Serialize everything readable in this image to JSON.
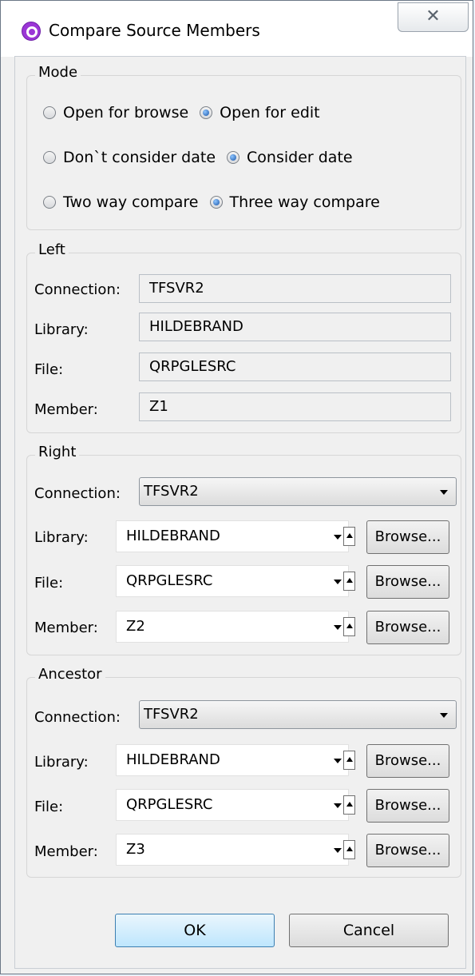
{
  "window": {
    "title": "Compare Source Members",
    "close_label": "✕"
  },
  "mode": {
    "legend": "Mode",
    "rows": [
      [
        {
          "label": "Open for browse",
          "selected": false
        },
        {
          "label": "Open for edit",
          "selected": true
        }
      ],
      [
        {
          "label": "Don`t consider date",
          "selected": false
        },
        {
          "label": "Consider date",
          "selected": true
        }
      ],
      [
        {
          "label": "Two way compare",
          "selected": false
        },
        {
          "label": "Three way compare",
          "selected": true
        }
      ]
    ]
  },
  "left": {
    "legend": "Left",
    "connection_label": "Connection:",
    "connection_value": "TFSVR2",
    "library_label": "Library:",
    "library_value": "HILDEBRAND",
    "file_label": "File:",
    "file_value": "QRPGLESRC",
    "member_label": "Member:",
    "member_value": "Z1"
  },
  "right": {
    "legend": "Right",
    "connection_label": "Connection:",
    "connection_value": "TFSVR2",
    "library_label": "Library:",
    "library_value": "HILDEBRAND",
    "file_label": "File:",
    "file_value": "QRPGLESRC",
    "member_label": "Member:",
    "member_value": "Z2",
    "browse_label": "Browse..."
  },
  "ancestor": {
    "legend": "Ancestor",
    "connection_label": "Connection:",
    "connection_value": "TFSVR2",
    "library_label": "Library:",
    "library_value": "HILDEBRAND",
    "file_label": "File:",
    "file_value": "QRPGLESRC",
    "member_label": "Member:",
    "member_value": "Z3",
    "browse_label": "Browse..."
  },
  "buttons": {
    "ok": "OK",
    "cancel": "Cancel"
  }
}
